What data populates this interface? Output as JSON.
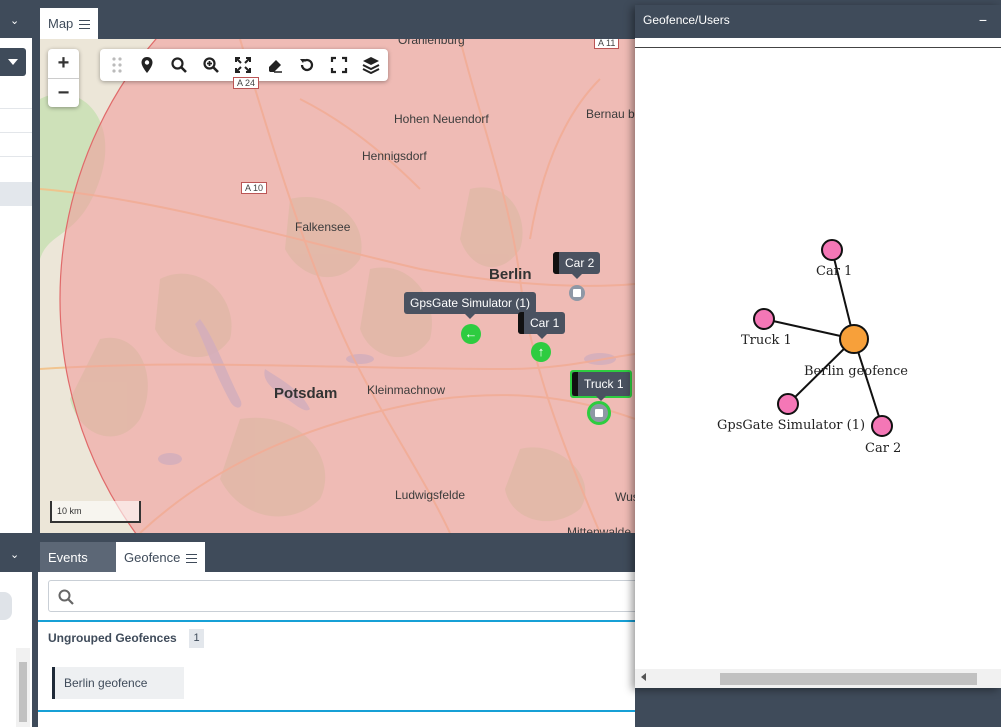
{
  "map_panel": {
    "tab_label": "Map",
    "zoom_in": "+",
    "zoom_out": "−",
    "scale_label": "10 km",
    "places": {
      "oranienburg": "Oranienburg",
      "hohen_neuendorf": "Hohen Neuendorf",
      "hennigsdorf": "Hennigsdorf",
      "falkensee": "Falkensee",
      "berlin": "Berlin",
      "potsdam": "Potsdam",
      "kleinmachnow": "Kleinmachnow",
      "ludwigsfelde": "Ludwigsfelde",
      "bernau": "Bernau b",
      "wus": "Wus",
      "mittenwalde": "Mittenwalde"
    },
    "roads": {
      "a11": "A 11",
      "a24": "A 24",
      "a10": "A 10"
    },
    "markers": {
      "car2": "Car 2",
      "car1": "Car 1",
      "gpsgate": "GpsGate Simulator (1)",
      "truck1": "Truck 1"
    },
    "colors": {
      "geofence_fill": "#f0a0a0",
      "marker_green": "#2ecc40"
    }
  },
  "bottom_panel": {
    "tabs": [
      "Events",
      "Geofence"
    ],
    "search_placeholder": "",
    "group_label": "Ungrouped Geofences",
    "group_count": "1",
    "geofence_item": "Berlin geofence"
  },
  "geofence_users_window": {
    "title": "Geofence/Users",
    "minimize": "−",
    "graph": {
      "center": "Berlin geofence",
      "nodes": [
        "Car 1",
        "Truck 1",
        "GpsGate Simulator (1)",
        "Car 2"
      ]
    },
    "colors": {
      "center_node": "#f7a03a",
      "leaf_node": "#f477b6"
    }
  }
}
